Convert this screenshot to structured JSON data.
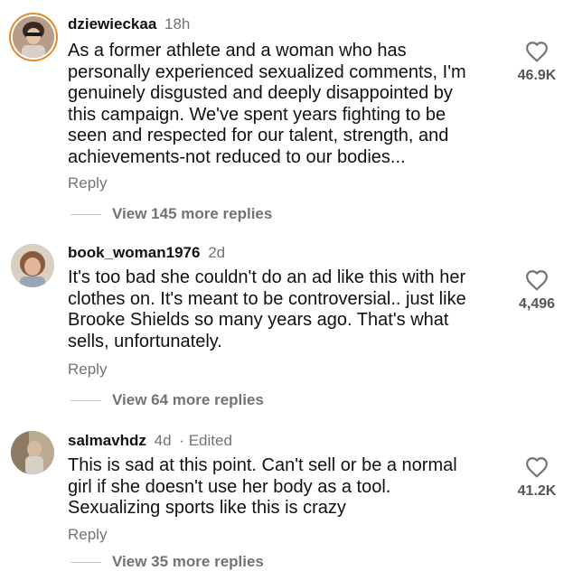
{
  "comments": [
    {
      "username": "dziewieckaa",
      "time": "18h",
      "edited": "",
      "text": "As a former athlete and a woman who has\npersonally experienced sexualized comments, I'm\ngenuinely disgusted and deeply disappointed by\nthis campaign. We've spent years fighting to be\nseen and respected for our talent, strength, and\nachievements-not reduced to our bodies...",
      "likes": "46.9K",
      "reply_label": "Reply",
      "view_replies": "View 145 more replies"
    },
    {
      "username": "book_woman1976",
      "time": "2d",
      "edited": "",
      "text": "It's too bad she couldn't do an ad like this with her\nclothes on. It's meant to be controversial.. just like\nBrooke Shields so many years ago. That's what\nsells, unfortunately.",
      "likes": "4,496",
      "reply_label": "Reply",
      "view_replies": "View 64 more replies"
    },
    {
      "username": "salmavhdz",
      "time": "4d",
      "edited": "· Edited",
      "text": "This is sad at this point. Can't sell or be a normal\ngirl if she doesn't use her body as a tool.\nSexualizing sports like this is crazy",
      "likes": "41.2K",
      "reply_label": "Reply",
      "view_replies": "View 35 more replies"
    }
  ],
  "icons": {
    "like": "heart-outline-icon"
  },
  "colors": {
    "story_ring": "#e48a2c",
    "secondary_text": "#737373"
  }
}
